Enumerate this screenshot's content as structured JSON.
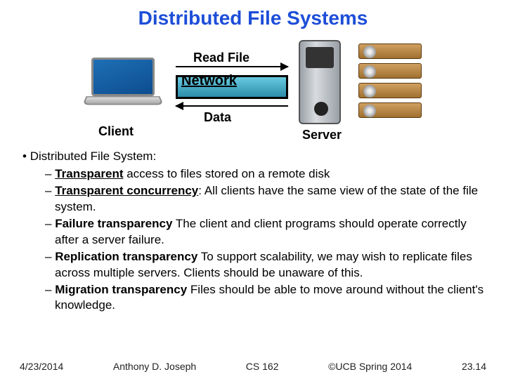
{
  "title": "Distributed File Systems",
  "diagram": {
    "read_file": "Read File",
    "network": "Network",
    "data": "Data",
    "client": "Client",
    "server": "Server"
  },
  "main_bullet_prefix": "• ",
  "main_bullet": "Distributed File System:",
  "items": [
    {
      "dash": "– ",
      "bold_u": "Transparent",
      "rest": " access to files stored on a remote disk"
    },
    {
      "dash": "– ",
      "bold_u": "Transparent concurrency",
      "rest": ": All clients have the same view of the state of the file system."
    },
    {
      "dash": "– ",
      "bold": "Failure transparency",
      "rest": " The client and client programs should operate correctly after a server failure."
    },
    {
      "dash": "– ",
      "bold": "Replication transparency",
      "rest": " To support scalability, we may wish to replicate files across multiple servers. Clients should be unaware of this."
    },
    {
      "dash": "– ",
      "bold": "Migration transparency",
      "rest": " Files should be able to move around without the client's knowledge."
    }
  ],
  "footer": {
    "date": "4/23/2014",
    "author": "Anthony D. Joseph",
    "course": "CS 162",
    "copyright": "©UCB Spring 2014",
    "slide": "23.14"
  }
}
